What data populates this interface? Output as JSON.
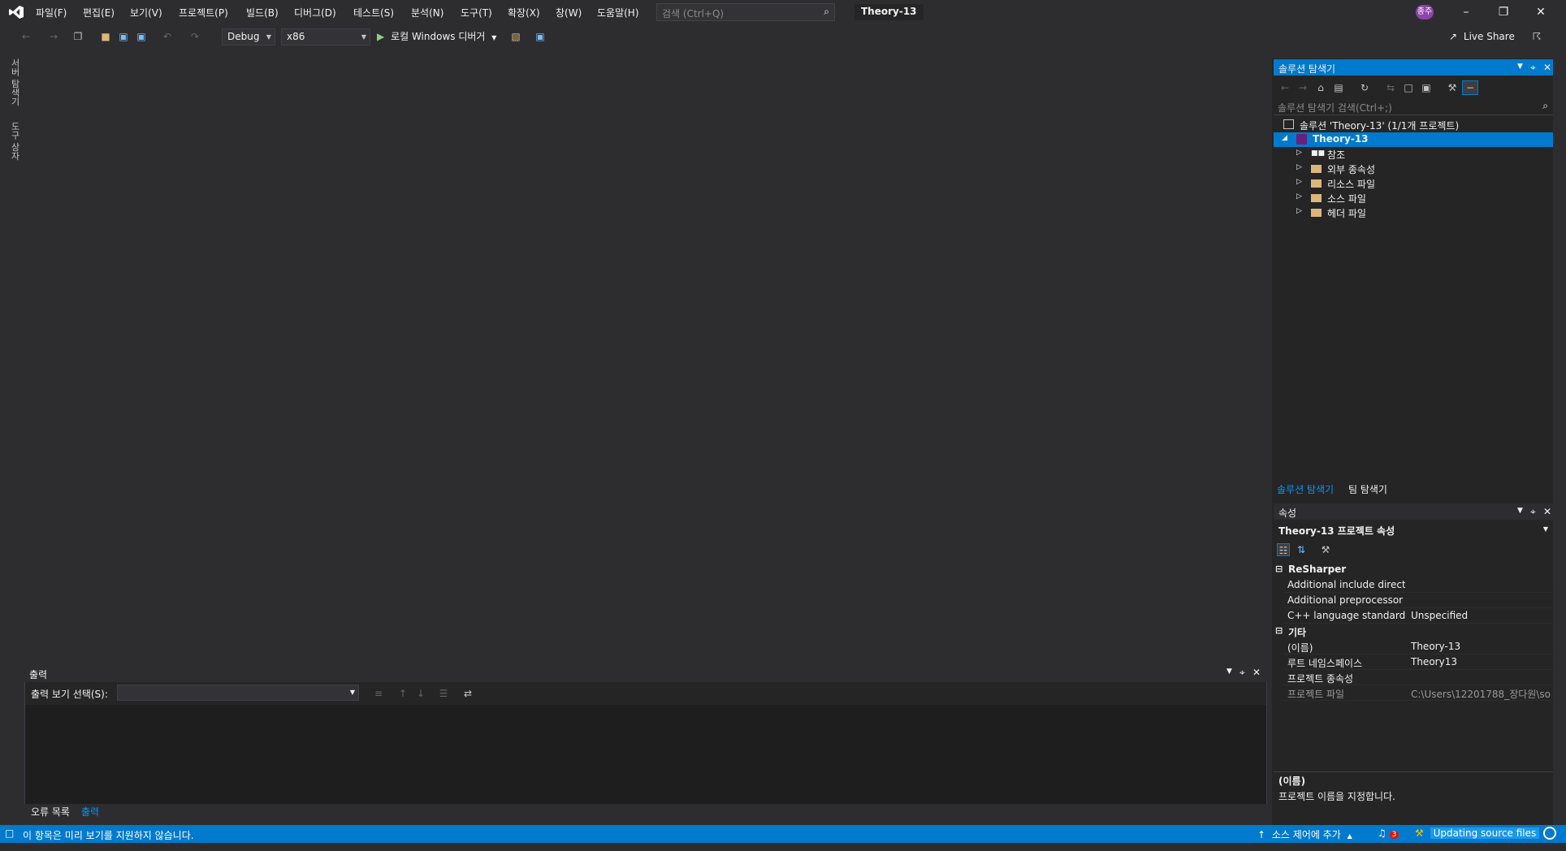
{
  "colors": {
    "accent": "#007acc",
    "background": "#2d2d30",
    "panel": "#252526",
    "selection": "#007acc"
  },
  "menu": [
    "파일(F)",
    "편집(E)",
    "보기(V)",
    "프로젝트(P)",
    "빌드(B)",
    "디버그(D)",
    "테스트(S)",
    "분석(N)",
    "도구(T)",
    "확장(X)",
    "창(W)",
    "도움말(H)"
  ],
  "search": {
    "placeholder": "검색 (Ctrl+Q)"
  },
  "title": "Theory-13",
  "user_badge": "종주",
  "live_share": "Live Share",
  "toolbar": {
    "config": "Debug",
    "platform": "x86",
    "run_label": "로컬 Windows 디버거"
  },
  "left_strip": {
    "server_explorer": "서버 탐색기",
    "toolbox": "도구 상자"
  },
  "solution_explorer": {
    "title": "솔루션 탐색기",
    "search_placeholder": "솔루션 탐색기 검색(Ctrl+;)",
    "solution_label": "솔루션 'Theory-13' (1/1개 프로젝트)",
    "project": "Theory-13",
    "items": [
      "참조",
      "외부 종속성",
      "리소스 파일",
      "소스 파일",
      "헤더 파일"
    ],
    "tab_solution": "솔루션 탐색기",
    "tab_team": "팀 탐색기"
  },
  "properties": {
    "title": "속성",
    "object": "Theory-13 프로젝트 속성",
    "groups": [
      {
        "name": "ReSharper",
        "rows": [
          {
            "name": "Additional include directori",
            "value": ""
          },
          {
            "name": "Additional preprocessor def",
            "value": ""
          },
          {
            "name": "C++ language standard",
            "value": "Unspecified"
          }
        ]
      },
      {
        "name": "기타",
        "rows": [
          {
            "name": "(이름)",
            "value": "Theory-13"
          },
          {
            "name": "루트 네임스페이스",
            "value": "Theory13"
          },
          {
            "name": "프로젝트 종속성",
            "value": ""
          },
          {
            "name": "프로젝트 파일",
            "value": "C:\\Users\\12201788_장다원\\so"
          }
        ]
      }
    ],
    "desc_title": "(이름)",
    "desc_text": "프로젝트 이름을 지정합니다."
  },
  "output": {
    "title": "출력",
    "select_label": "출력 보기 선택(S):",
    "tab_errors": "오류 목록",
    "tab_output": "출력"
  },
  "status": {
    "message": "이 항목은 미리 보기를 지원하지 않습니다.",
    "source_control": "소스 제어에 추가",
    "notifications": "3",
    "updating": "Updating source files"
  }
}
